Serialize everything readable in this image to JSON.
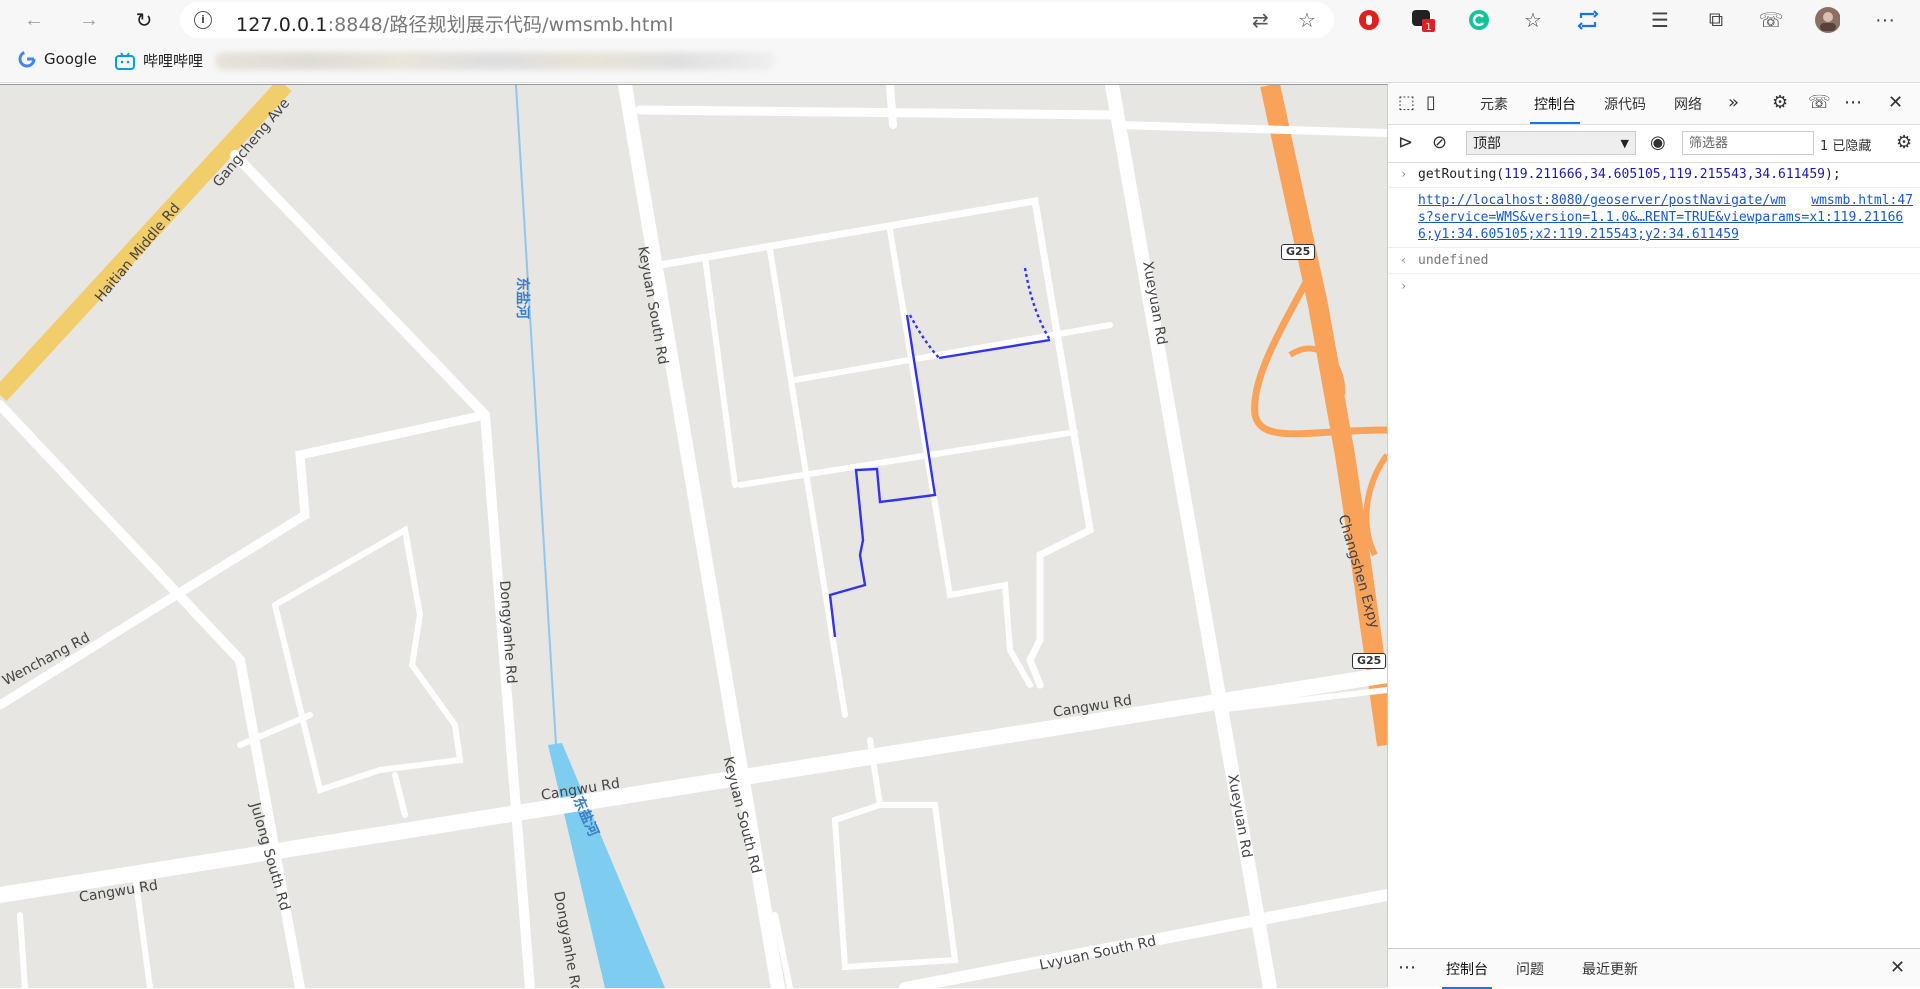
{
  "browser": {
    "url_host": "127.0.0.1",
    "url_rest": ":8848/路径规划展示代码/wmsmb.html",
    "badge_count": "1",
    "bookmarks": [
      "Google",
      "哔哩哔哩"
    ]
  },
  "map": {
    "road_labels": [
      "Haitian Middle Rd",
      "Gangcheng Ave",
      "Keyuan South Rd",
      "Xueyuan Rd",
      "Wenchang Rd",
      "Dongyanhe Rd",
      "Cangwu Rd",
      "Cangwu Rd",
      "Cangwu Rd",
      "Julong South Rd",
      "Keyuan South Rd",
      "Xueyuan Rd",
      "Dongyanhe Rd",
      "Changshen Expy",
      "Lvyuan South Rd"
    ],
    "river_labels": [
      "东盐河",
      "东盐河"
    ],
    "shields": [
      "G25",
      "G25"
    ],
    "colors": {
      "background": "#e8e6e2",
      "road": "#ffffff",
      "route": "#3333ee",
      "river": "#7ecdf0",
      "expressway": "#f9a35a",
      "arterial": "#f2cd6b"
    }
  },
  "devtools": {
    "tabs": [
      "元素",
      "控制台",
      "源代码",
      "网络"
    ],
    "context": "顶部",
    "filter_placeholder": "筛选器",
    "hidden": "1 已隐藏",
    "console": {
      "input": "getRouting(",
      "args": "119.211666,34.605105,119.215543,34.611459",
      "input_end": ");",
      "link": "http://localhost:8080/geoserver/postNavigate/wms?service=WMS&version=1.1.0&…RENT=TRUE&viewparams=x1:119.211666;y1:34.605105;x2:119.215543;y2:34.611459",
      "source": "wmsmb.html:47",
      "result": "undefined"
    },
    "drawer_tabs": [
      "控制台",
      "问题",
      "最近更新"
    ]
  }
}
